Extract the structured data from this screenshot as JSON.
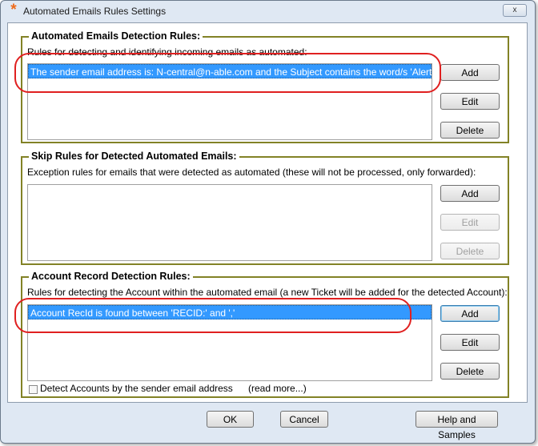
{
  "window": {
    "title": "Automated Emails Rules Settings",
    "app_icon": "*",
    "close": "x"
  },
  "detection": {
    "title": "Automated Emails Detection Rules:",
    "description": "Rules for detecting and identifying incoming emails as automated:",
    "items": [
      "The sender email address is: N-central@n-able.com and the Subject contains the word/s 'Alert'"
    ],
    "buttons": {
      "add": "Add",
      "edit": "Edit",
      "delete": "Delete"
    }
  },
  "skip": {
    "title": "Skip Rules for Detected Automated Emails:",
    "description": "Exception rules for emails that were detected as automated (these will not be processed, only forwarded):",
    "buttons": {
      "add": "Add",
      "edit": "Edit",
      "delete": "Delete"
    }
  },
  "account": {
    "title": "Account Record Detection Rules:",
    "description": "Rules for detecting the Account within the automated email (a new Ticket will be added for the detected Account):",
    "items": [
      "Account RecId is found between 'RECID:' and ','"
    ],
    "buttons": {
      "add": "Add",
      "edit": "Edit",
      "delete": "Delete"
    },
    "checkbox_label": "Detect Accounts by the sender email address",
    "read_more": "(read more...)"
  },
  "footer": {
    "ok": "OK",
    "cancel": "Cancel",
    "help": "Help and Samples"
  },
  "colors": {
    "group_border": "#828226",
    "selection": "#3399ff",
    "highlight": "#e02020"
  }
}
